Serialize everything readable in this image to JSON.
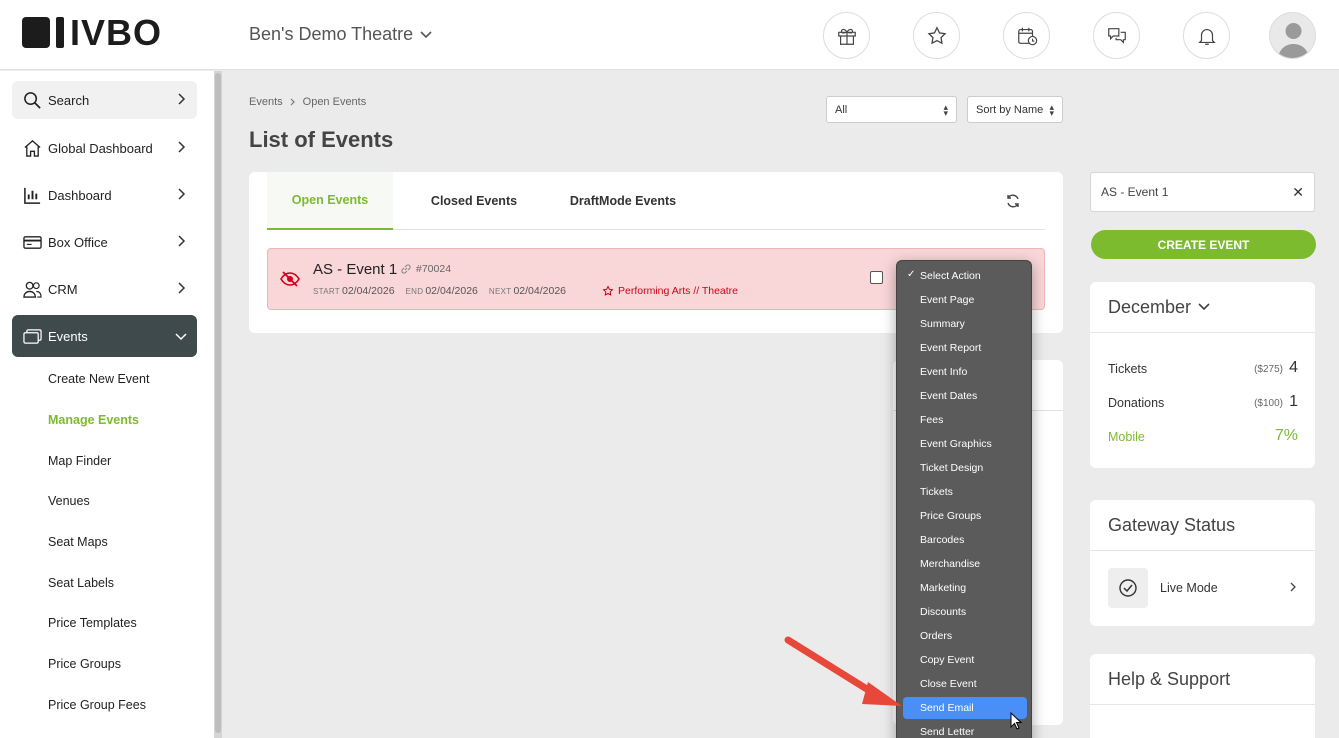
{
  "header": {
    "logo_text": "IVBO",
    "venue_name": "Ben's Demo Theatre",
    "icons": [
      "gift-box-icon",
      "star-icon",
      "calendar-clock-icon",
      "chat-bubbles-icon",
      "bell-icon"
    ]
  },
  "sidebar": {
    "items": [
      {
        "label": "Search",
        "icon": "search-icon"
      },
      {
        "label": "Global Dashboard",
        "icon": "home-icon"
      },
      {
        "label": "Dashboard",
        "icon": "bar-chart-icon"
      },
      {
        "label": "Box Office",
        "icon": "credit-card-icon"
      },
      {
        "label": "CRM",
        "icon": "users-icon"
      },
      {
        "label": "Events",
        "icon": "tickets-icon"
      }
    ],
    "sub_items": [
      "Create New Event",
      "Manage Events",
      "Map Finder",
      "Venues",
      "Seat Maps",
      "Seat Labels",
      "Price Templates",
      "Price Groups",
      "Price Group Fees"
    ],
    "active_sub": "Manage Events"
  },
  "main": {
    "breadcrumb": [
      "Events",
      "Open Events"
    ],
    "title": "List of Events",
    "filter_select": "All",
    "sort_select": "Sort by Name",
    "tabs": [
      "Open Events",
      "Closed Events",
      "DraftMode Events"
    ],
    "active_tab": "Open Events"
  },
  "event": {
    "name": "AS - Event 1",
    "id": "#70024",
    "start_label": "START",
    "start": "02/04/2026",
    "end_label": "END",
    "end": "02/04/2026",
    "next_label": "NEXT",
    "next": "02/04/2026",
    "category": "Performing Arts // Theatre"
  },
  "action_menu": {
    "items": [
      "Select Action",
      "Event Page",
      "Summary",
      "Event Report",
      "Event Info",
      "Event Dates",
      "Fees",
      "Event Graphics",
      "Ticket Design",
      "Tickets",
      "Price Groups",
      "Barcodes",
      "Merchandise",
      "Marketing",
      "Discounts",
      "Orders",
      "Copy Event",
      "Close Event",
      "Send Email",
      "Send Letter"
    ],
    "checked": "Select Action",
    "highlighted": "Send Email"
  },
  "right": {
    "search_value": "AS - Event 1",
    "create_button": "CREATE EVENT",
    "month": "December",
    "stats": [
      {
        "label": "Tickets",
        "amount": "($275)",
        "count": "4"
      },
      {
        "label": "Donations",
        "amount": "($100)",
        "count": "1"
      },
      {
        "label": "Mobile",
        "amount": "",
        "count": "7%"
      }
    ],
    "gateway_title": "Gateway Status",
    "gateway_value": "Live Mode",
    "help_title": "Help & Support"
  },
  "colors": {
    "accent": "#7dbb2e",
    "sidebar_active": "#3f4a4c",
    "event_row_bg": "#f9d6d8",
    "menu_bg": "#5b5b5b",
    "menu_highlight": "#4a8ff7",
    "annotation_arrow": "#e8483a"
  }
}
